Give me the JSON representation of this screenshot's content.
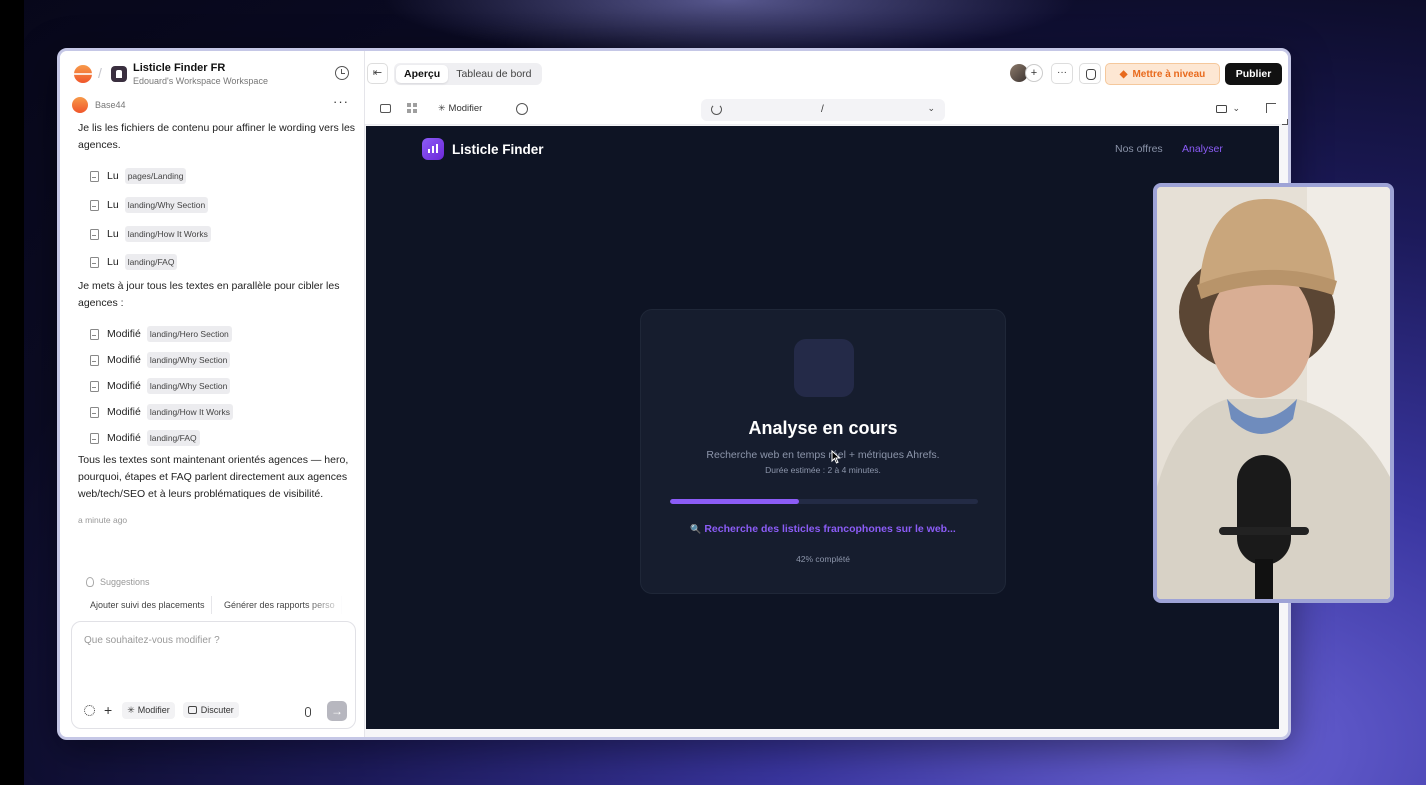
{
  "project": {
    "title": "Listicle Finder FR",
    "workspace": "Edouard's Workspace Workspace"
  },
  "chat": {
    "agent_name": "Base44",
    "messages": [
      "Je lis les fichiers de contenu pour affiner le wording vers les agences.",
      "Je mets à jour tous les textes en parallèle pour cibler les agences :",
      "Tous les textes sont maintenant orientés agences — hero, pourquoi, étapes et FAQ parlent directement aux agences web/tech/SEO et à leurs problématiques de visibilité."
    ],
    "read_files": [
      {
        "verb": "Lu",
        "file": "pages/Landing"
      },
      {
        "verb": "Lu",
        "file": "landing/Why Section"
      },
      {
        "verb": "Lu",
        "file": "landing/How It Works"
      },
      {
        "verb": "Lu",
        "file": "landing/FAQ"
      }
    ],
    "modified_files": [
      {
        "verb": "Modifié",
        "file": "landing/Hero Section"
      },
      {
        "verb": "Modifié",
        "file": "landing/Why Section"
      },
      {
        "verb": "Modifié",
        "file": "landing/Why Section"
      },
      {
        "verb": "Modifié",
        "file": "landing/How It Works"
      },
      {
        "verb": "Modifié",
        "file": "landing/FAQ"
      }
    ],
    "timestamp": "a minute ago",
    "suggestions_title": "Suggestions",
    "suggestions": [
      "Ajouter suivi des placements",
      "Générer des rapports perso"
    ],
    "composer_placeholder": "Que souhaitez-vous modifier ?",
    "composer_modify": "Modifier",
    "composer_discuss": "Discuter"
  },
  "topbar": {
    "tabs": [
      "Aperçu",
      "Tableau de bord"
    ],
    "upgrade_label": "Mettre à niveau",
    "publish_label": "Publier"
  },
  "toolbar": {
    "edit_label": "Modifier",
    "url_path": "/"
  },
  "preview": {
    "brand": "Listicle Finder",
    "nav": [
      "Nos offres",
      "Analyser"
    ],
    "card": {
      "title": "Analyse en cours",
      "subtitle": "Recherche web en temps réel + métriques Ahrefs.",
      "eta": "Durée estimée : 2 à 4 minutes.",
      "progress_percent": 42,
      "step": "Recherche des listicles francophones sur le web...",
      "progress_label": "42% complété"
    }
  },
  "colors": {
    "accent": "#8b5cf6",
    "upgrade": "#e86a1d",
    "preview_bg": "#0e1424"
  }
}
